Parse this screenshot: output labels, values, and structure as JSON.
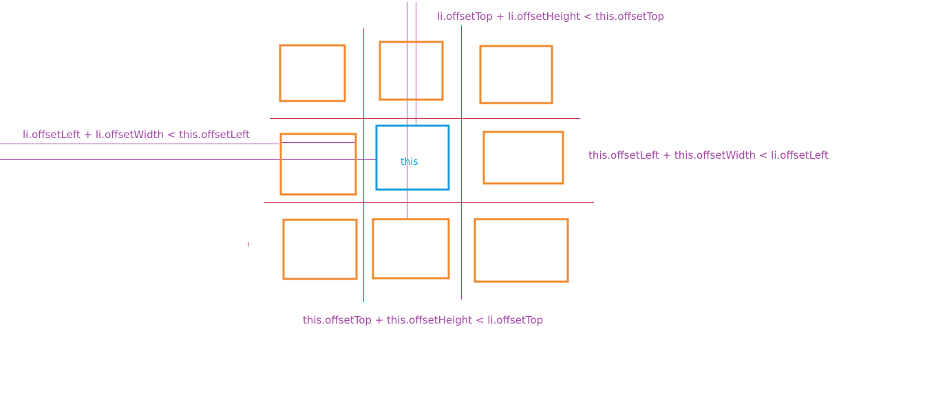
{
  "colors": {
    "box": "#f08a2e",
    "this_box": "#1b9fdb",
    "grid_line": "#c9344a",
    "annotation": "#a347a6",
    "this_text": "#1b9fdb"
  },
  "labels": {
    "this": "this",
    "above": "li.offsetTop + li.offsetHeight < this.offsetTop",
    "left": "li.offsetLeft + li.offsetWidth < this.offsetLeft",
    "right": "this.offsetLeft + this.offsetWidth < li.offsetLeft",
    "below": "this.offsetTop + this.offsetHeight < li.offsetTop"
  }
}
